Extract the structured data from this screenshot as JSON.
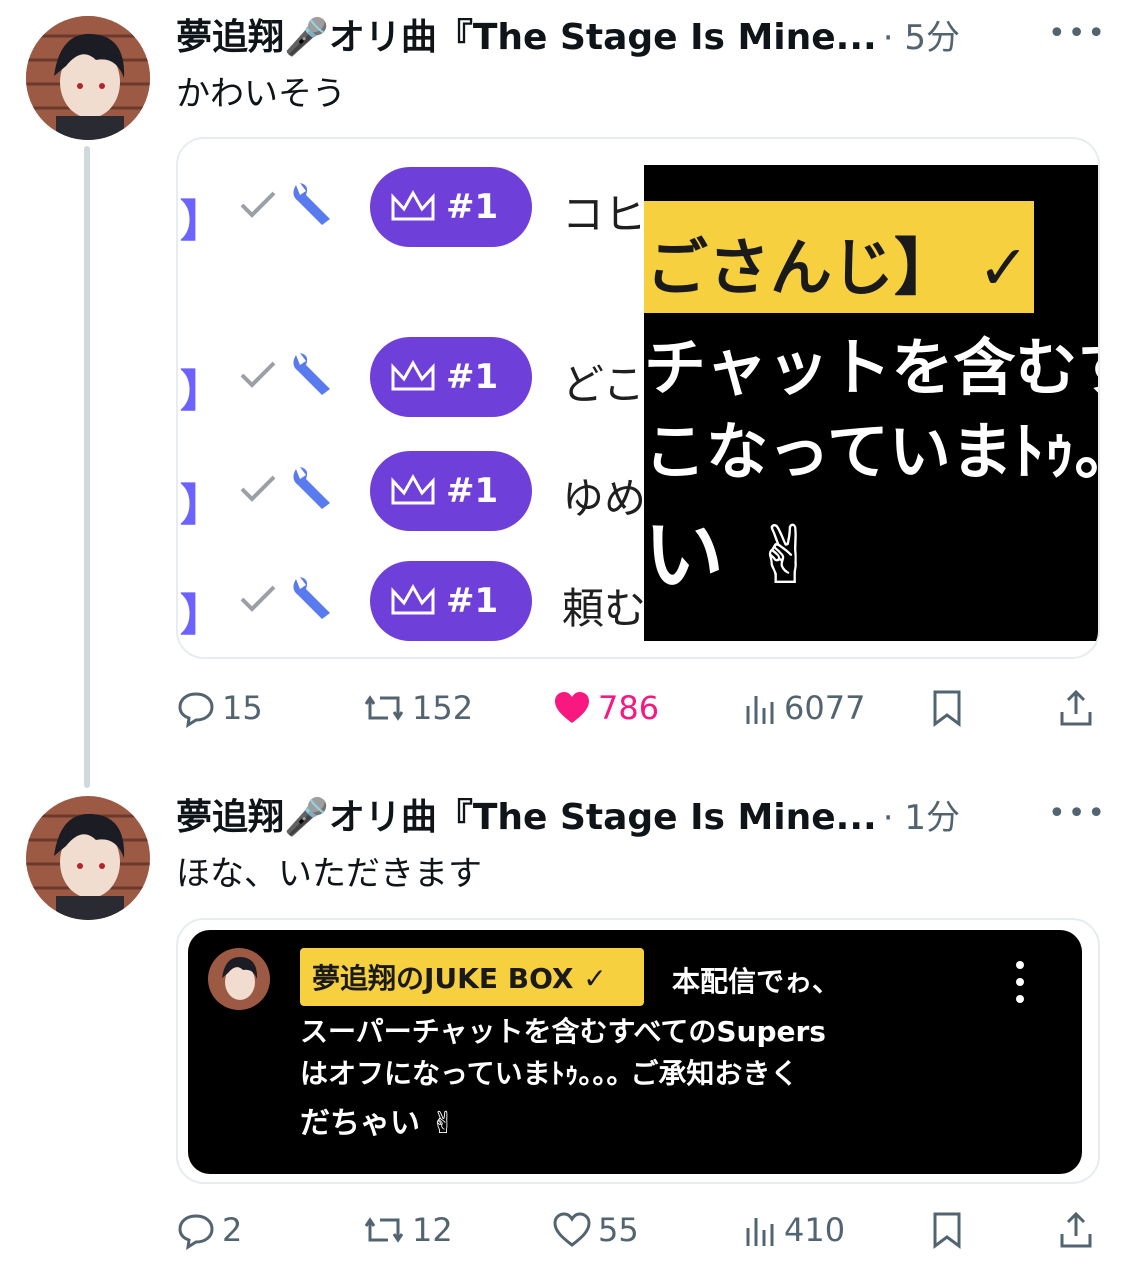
{
  "tweets": [
    {
      "author": "夢追翔🎤オリ曲『The Stage Is Mine...",
      "time": "· 5分",
      "text": "かわいそう",
      "media": {
        "chat_rows": [
          {
            "rank": "#1",
            "text": "コヒ"
          },
          {
            "rank": "#1",
            "text": "どこ"
          },
          {
            "rank": "#1",
            "text": "ゆめ"
          },
          {
            "rank": "#1",
            "text": "頼む"
          }
        ],
        "bracket": "】",
        "zoom_badge": "ごさんじ】 ✓",
        "zoom_line1": "チャットを含むす",
        "zoom_line2": "こなっていまﾄｩ｡｡",
        "zoom_line3": "い ✌"
      },
      "replies": "15",
      "retweets": "152",
      "likes": "786",
      "views": "6077",
      "liked": true
    },
    {
      "author": "夢追翔🎤オリ曲『The Stage Is Mine...",
      "time": "· 1分",
      "text": "ほな、いただきます",
      "media": {
        "badge": "夢追翔のJUKE BOX ✓",
        "line1": "本配信でゎ、",
        "line2": "スーパーチャットを含むすべてのSupers",
        "line3": "はオフになっていまﾄｩ｡｡｡ ご承知おきく",
        "line4": "だちゃい ✌"
      },
      "replies": "2",
      "retweets": "12",
      "likes": "55",
      "views": "410",
      "liked": false
    }
  ],
  "more_label": "•••",
  "colors": {
    "like": "#f91880",
    "muted": "#536471",
    "pill": "#6f3fd9",
    "badge": "#f6d03f"
  }
}
